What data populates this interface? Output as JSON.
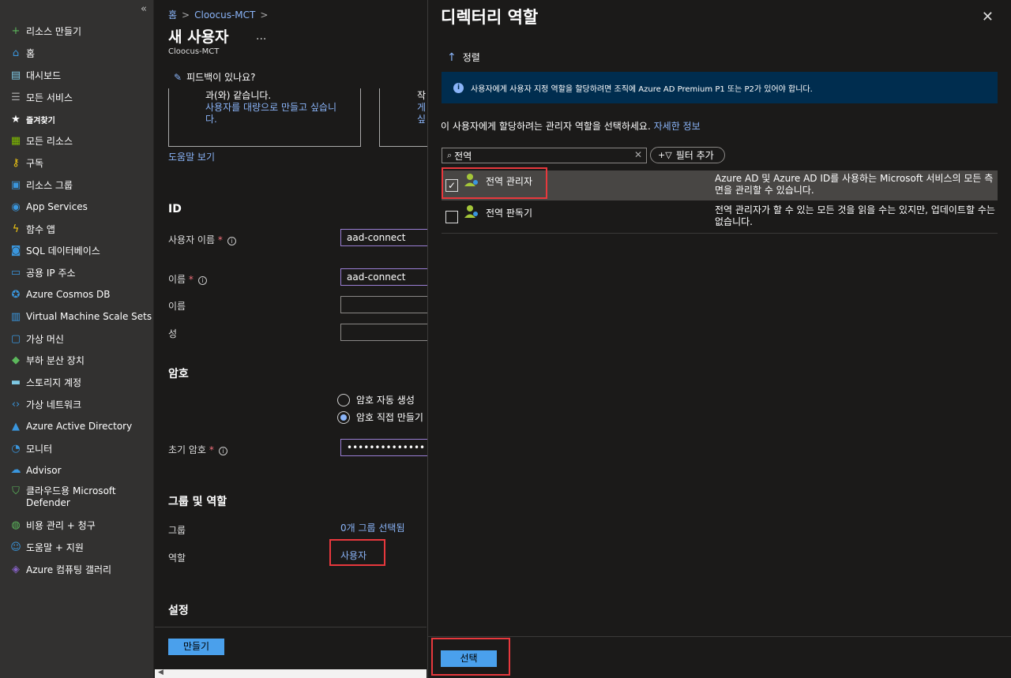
{
  "sidebar": {
    "collapse_glyph": "«",
    "items": [
      {
        "label": "리소스 만들기",
        "icon": "plus-icon",
        "glyph": "+",
        "color": "#5cb85c"
      },
      {
        "label": "홈",
        "icon": "home-icon",
        "glyph": "⌂",
        "color": "#3a96dd"
      },
      {
        "label": "대시보드",
        "icon": "dashboard-icon",
        "glyph": "▤",
        "color": "#7ec8e3"
      },
      {
        "label": "모든 서비스",
        "icon": "list-icon",
        "glyph": "☰",
        "color": "#aaaaaa"
      },
      {
        "label": "즐겨찾기",
        "icon": "star-icon",
        "glyph": "★",
        "color": "#ffffff"
      },
      {
        "label": "모든 리소스",
        "icon": "grid-icon",
        "glyph": "▦",
        "color": "#7fba00"
      },
      {
        "label": "구독",
        "icon": "key-icon",
        "glyph": "⚷",
        "color": "#f2c811"
      },
      {
        "label": "리소스 그룹",
        "icon": "resource-group-icon",
        "glyph": "▣",
        "color": "#3a96dd"
      },
      {
        "label": "App Services",
        "icon": "app-services-icon",
        "glyph": "◉",
        "color": "#3a96dd"
      },
      {
        "label": "함수 앱",
        "icon": "function-icon",
        "glyph": "ϟ",
        "color": "#f2c811"
      },
      {
        "label": "SQL 데이터베이스",
        "icon": "sql-database-icon",
        "glyph": "◙",
        "color": "#3a96dd"
      },
      {
        "label": "공용 IP 주소",
        "icon": "public-ip-icon",
        "glyph": "▭",
        "color": "#3a96dd"
      },
      {
        "label": "Azure Cosmos DB",
        "icon": "cosmos-db-icon",
        "glyph": "✪",
        "color": "#3a96dd"
      },
      {
        "label": "Virtual Machine Scale Sets",
        "icon": "vmss-icon",
        "glyph": "▥",
        "color": "#3a96dd"
      },
      {
        "label": "가상 머신",
        "icon": "virtual-machine-icon",
        "glyph": "▢",
        "color": "#3a96dd"
      },
      {
        "label": "부하 분산 장치",
        "icon": "load-balancer-icon",
        "glyph": "◆",
        "color": "#5cb85c"
      },
      {
        "label": "스토리지 계정",
        "icon": "storage-icon",
        "glyph": "▬",
        "color": "#7ec8e3"
      },
      {
        "label": "가상 네트워크",
        "icon": "vnet-icon",
        "glyph": "‹›",
        "color": "#3a96dd"
      },
      {
        "label": "Azure Active Directory",
        "icon": "aad-icon",
        "glyph": "▲",
        "color": "#3a96dd"
      },
      {
        "label": "모니터",
        "icon": "monitor-icon",
        "glyph": "◔",
        "color": "#3a96dd"
      },
      {
        "label": "Advisor",
        "icon": "advisor-icon",
        "glyph": "☁",
        "color": "#3a96dd"
      },
      {
        "label": "클라우드용 Microsoft Defender",
        "icon": "defender-icon",
        "glyph": "⛉",
        "color": "#5cb85c"
      },
      {
        "label": "비용 관리 + 청구",
        "icon": "cost-icon",
        "glyph": "◍",
        "color": "#5cb85c"
      },
      {
        "label": "도움말 + 지원",
        "icon": "help-support-icon",
        "glyph": "☺",
        "color": "#3a96dd"
      },
      {
        "label": "Azure 컴퓨팅 갤러리",
        "icon": "gallery-icon",
        "glyph": "◈",
        "color": "#8661c5"
      }
    ]
  },
  "main": {
    "breadcrumb_home": "홈",
    "breadcrumb_tenant": "Cloocus-MCT",
    "breadcrumb_sep": ">",
    "title": "새 사용자",
    "ellipsis": "...",
    "subtitle": "Cloocus-MCT",
    "feedback": "피드백이 있나요?",
    "card1_text": "과(와) 같습니다.",
    "card1_link": "사용자를 대량으로 만들고 싶습니\n다.",
    "card2_line1": "작",
    "card2_line2": "게",
    "card2_line3": "싶",
    "help_link": "도움말 보기",
    "id_section": "ID",
    "username_label": "사용자 이름",
    "username_value": "aad-connect",
    "name_label": "이름",
    "name_value": "aad-connect",
    "firstname_label": "이름",
    "lastname_label": "성",
    "password_section": "암호",
    "radio_auto": "암호 자동 생성",
    "radio_manual": "암호 직접 만들기",
    "initial_pw_label": "초기 암호",
    "initial_pw_value": "••••••••••••••",
    "groups_section": "그룹 및 역할",
    "groups_label": "그룹",
    "groups_value": "0개 그룹 선택됨",
    "roles_label": "역할",
    "roles_value": "사용자",
    "settings_section": "설정",
    "create_button": "만들기",
    "required_mark": "*",
    "info_glyph": "i"
  },
  "panel": {
    "title": "디렉터리 역할",
    "close_glyph": "✕",
    "sort_label": "정렬",
    "info_message": "사용자에게 사용자 지정 역할을 할당하려면 조직에 Azure AD Premium P1 또는 P2가 있어야 합니다.",
    "instruction": "이 사용자에게 할당하려는 관리자 역할을 선택하세요.",
    "learn_more": "자세한 정보",
    "search_value": "전역",
    "filter_label": "필터 추가",
    "roles": [
      {
        "name": "전역 관리자",
        "checked": true,
        "description": "Azure AD 및 Azure AD ID를 사용하는 Microsoft 서비스의 모든 측면을 관리할 수 있습니다."
      },
      {
        "name": "전역 판독기",
        "checked": false,
        "description": "전역 관리자가 할 수 있는 모든 것을 읽을 수는 있지만, 업데이트할 수는 없습니다."
      }
    ],
    "select_button": "선택"
  },
  "colors": {
    "accent": "#4aa0ec",
    "link": "#8ab4f8",
    "highlight": "#e8383d",
    "info_bar": "#002d4f"
  }
}
